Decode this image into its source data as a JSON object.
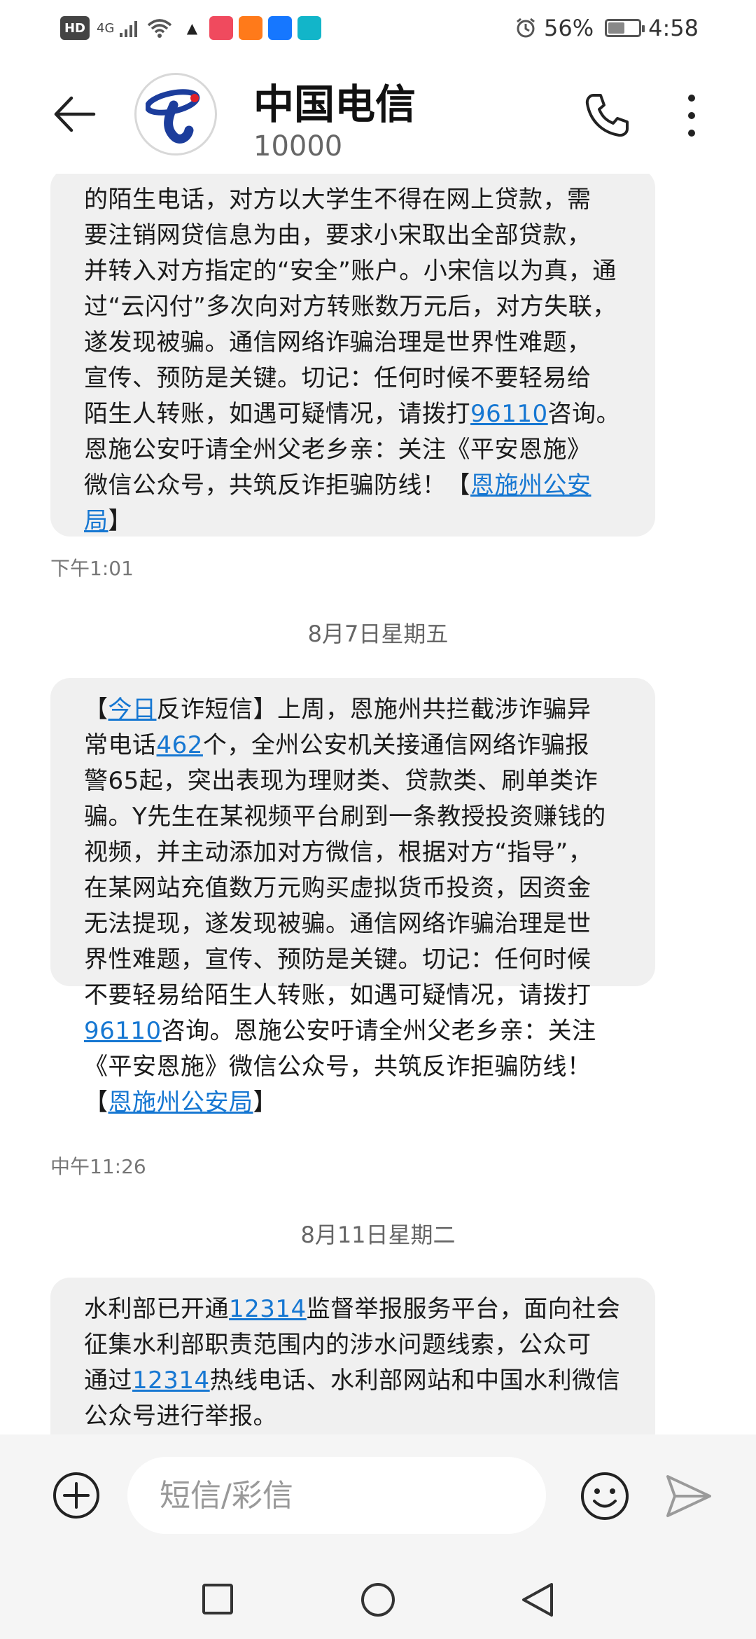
{
  "status_bar": {
    "hd": "HD",
    "network": "4G",
    "apps": [
      {
        "icon": "qq-icon",
        "color": "#222222"
      },
      {
        "icon": "app-red-icon",
        "color": "#f04a5e"
      },
      {
        "icon": "app-orange-icon",
        "color": "#ff7a1a"
      },
      {
        "icon": "alipay-icon",
        "color": "#1677ff"
      },
      {
        "icon": "app-teal-icon",
        "color": "#12b5c9"
      }
    ],
    "battery_percent": "56%",
    "battery_level": 0.56,
    "time": "4:58"
  },
  "header": {
    "contact_name": "中国电信",
    "contact_number": "10000",
    "brand_color": "#1c3d9c"
  },
  "messages": [
    {
      "lines": [
        [
          "的陌生电话，对方以大学生不得在网上贷款，需"
        ],
        [
          "要注销网贷信息为由，要求小宋取出全部贷款，"
        ],
        [
          "并转入对方指定的“安全”账户。小宋信以为真，通"
        ],
        [
          "过“云闪付”多次向对方转账数万元后，对方失联，"
        ],
        [
          "遂发现被骗。通信网络诈骗治理是世界性难题，"
        ],
        [
          "宣传、预防是关键。切记：任何时候不要轻易给"
        ],
        [
          "陌生人转账，如遇可疑情况，请拨打",
          {
            "link": "96110"
          },
          "咨询。"
        ],
        [
          "恩施公安吁请全州父老乡亲：关注《平安恩施》"
        ],
        [
          "微信公众号，共筑反诈拒骗防线！【",
          {
            "link": "恩施州公安"
          }
        ],
        [
          {
            "link": "局"
          },
          "】"
        ]
      ],
      "time": "下午1:01"
    },
    {
      "date": "8月7日星期五",
      "lines": [
        [
          "【",
          {
            "link": "今日"
          },
          "反诈短信】上周，恩施州共拦截涉诈骗异"
        ],
        [
          "常电话",
          {
            "link": "462"
          },
          "个，全州公安机关接通信网络诈骗报"
        ],
        [
          "警65起，突出表现为理财类、贷款类、刷单类诈"
        ],
        [
          "骗。Y先生在某视频平台刷到一条教授投资赚钱的"
        ],
        [
          "视频，并主动添加对方微信，根据对方“指导”，"
        ],
        [
          "在某网站充值数万元购买虚拟货币投资，因资金"
        ],
        [
          "无法提现，遂发现被骗。通信网络诈骗治理是世"
        ],
        [
          "界性难题，宣传、预防是关键。切记：任何时候"
        ],
        [
          "不要轻易给陌生人转账，如遇可疑情况，请拨打"
        ],
        [
          {
            "link": "96110"
          },
          "咨询。恩施公安吁请全州父老乡亲：关注"
        ],
        [
          "《平安恩施》微信公众号，共筑反诈拒骗防线！"
        ],
        [
          "【",
          {
            "link": "恩施州公安局"
          },
          "】"
        ]
      ],
      "time": "中午11:26"
    },
    {
      "date": "8月11日星期二",
      "lines": [
        [
          "水利部已开通",
          {
            "link": "12314"
          },
          "监督举报服务平台，面向社会"
        ],
        [
          "征集水利部职责范围内的涉水问题线索，公众可"
        ],
        [
          "通过",
          {
            "link": "12314"
          },
          "热线电话、水利部网站和中国水利微信"
        ],
        [
          "公众号进行举报。"
        ]
      ]
    }
  ],
  "composer": {
    "placeholder": "短信/彩信"
  },
  "colors": {
    "link": "#1677d2",
    "bubble": "#f0f0f0"
  }
}
